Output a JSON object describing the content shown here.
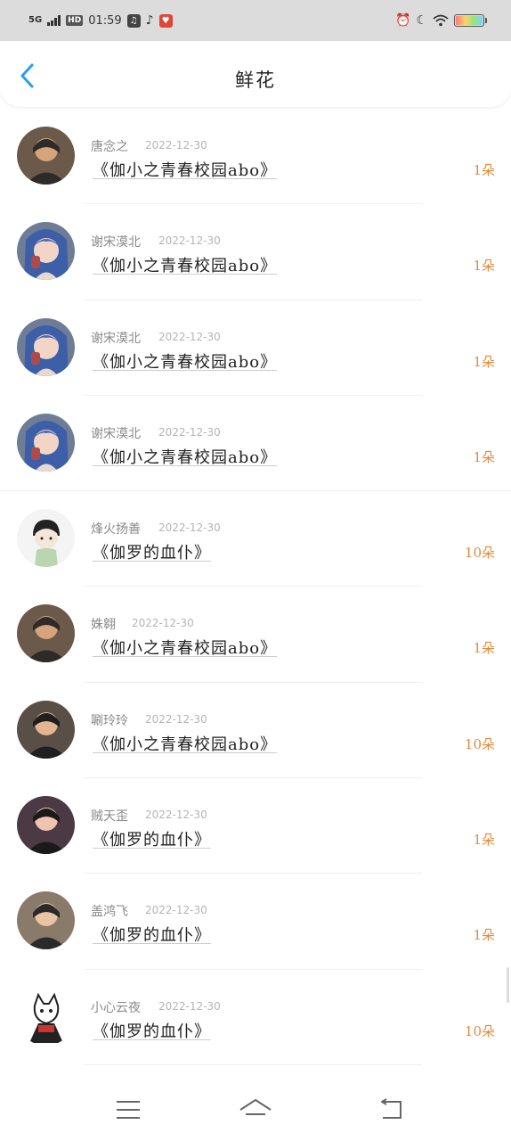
{
  "status_bar": {
    "network": "5G",
    "hd": "HD",
    "time": "01:59",
    "apps": [
      "music-app-icon",
      "tiktok-icon",
      "gift-app-icon"
    ],
    "right_icons": [
      "alarm-icon",
      "moon-icon",
      "wifi-icon",
      "battery-icon"
    ]
  },
  "header": {
    "title": "鲜花",
    "back_icon": "chevron-left-icon",
    "accent": "#2b9bf4"
  },
  "colors": {
    "count_color": "#e38a3c",
    "name_color": "#8a8a8a",
    "date_color": "#b5b5b5"
  },
  "list": [
    {
      "name": "唐念之",
      "date": "2022-12-30",
      "book": "《伽小之青春校园abo》",
      "count": "1朵",
      "avatar": "photo-avatar"
    },
    {
      "name": "谢宋漠北",
      "date": "2022-12-30",
      "book": "《伽小之青春校园abo》",
      "count": "1朵",
      "avatar": "anime-avatar"
    },
    {
      "name": "谢宋漠北",
      "date": "2022-12-30",
      "book": "《伽小之青春校园abo》",
      "count": "1朵",
      "avatar": "anime-avatar"
    },
    {
      "name": "谢宋漠北",
      "date": "2022-12-30",
      "book": "《伽小之青春校园abo》",
      "count": "1朵",
      "avatar": "anime-avatar"
    },
    {
      "name": "烽火扬善",
      "date": "2022-12-30",
      "book": "《伽罗的血仆》",
      "count": "10朵",
      "avatar": "cartoon-avatar"
    },
    {
      "name": "姝翱",
      "date": "2022-12-30",
      "book": "《伽小之青春校园abo》",
      "count": "1朵",
      "avatar": "photo-avatar"
    },
    {
      "name": "唰玲玲",
      "date": "2022-12-30",
      "book": "《伽小之青春校园abo》",
      "count": "10朵",
      "avatar": "photo-avatar"
    },
    {
      "name": "贼天歪",
      "date": "2022-12-30",
      "book": "《伽罗的血仆》",
      "count": "1朵",
      "avatar": "photo-avatar"
    },
    {
      "name": "盖鸿飞",
      "date": "2022-12-30",
      "book": "《伽罗的血仆》",
      "count": "1朵",
      "avatar": "photo-avatar"
    },
    {
      "name": "小心云夜",
      "date": "2022-12-30",
      "book": "《伽罗的血仆》",
      "count": "10朵",
      "avatar": "cartoon-avatar"
    }
  ],
  "nav_bar": {
    "items": [
      "menu-icon",
      "home-icon",
      "back-icon"
    ]
  }
}
